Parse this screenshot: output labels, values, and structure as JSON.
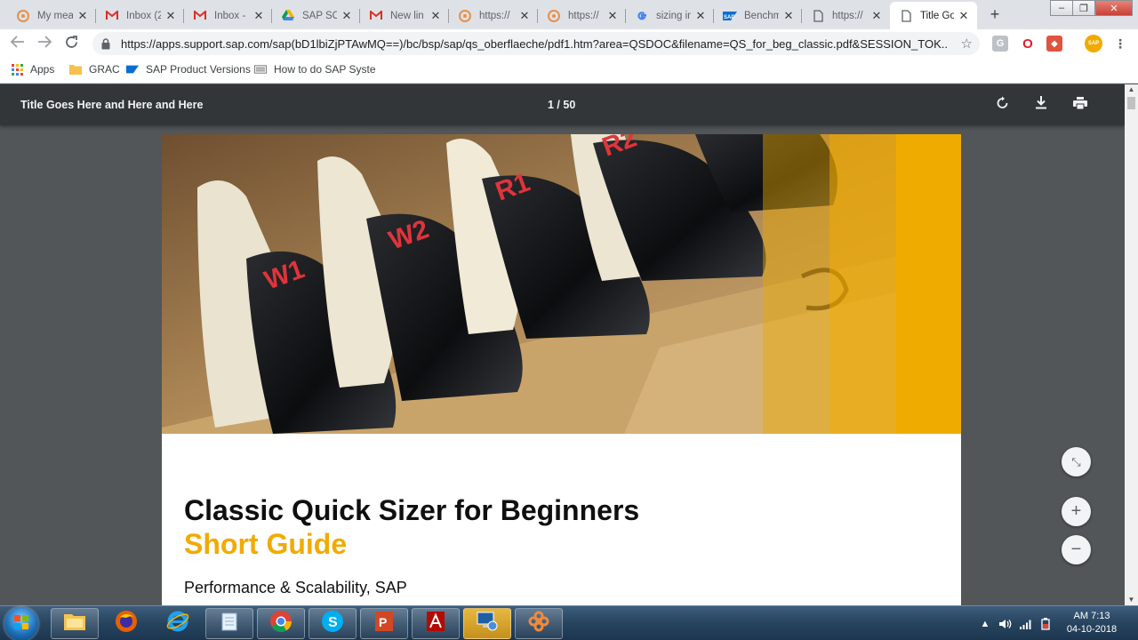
{
  "browser": {
    "tabs": [
      {
        "title": "My mea",
        "icon": "sap-flower-icon"
      },
      {
        "title": "Inbox (2",
        "icon": "gmail-icon"
      },
      {
        "title": "Inbox -",
        "icon": "gmail-icon"
      },
      {
        "title": "SAP SO",
        "icon": "google-drive-icon"
      },
      {
        "title": "New lin",
        "icon": "gmail-icon"
      },
      {
        "title": "https://",
        "icon": "sap-flower-icon"
      },
      {
        "title": "https://",
        "icon": "sap-flower-icon"
      },
      {
        "title": "sizing in",
        "icon": "google-icon"
      },
      {
        "title": "Benchm",
        "icon": "sap-logo-icon"
      },
      {
        "title": "https://",
        "icon": "page-icon"
      },
      {
        "title": "Title Go",
        "icon": "page-icon",
        "active": true
      }
    ],
    "new_tab_symbol": "+",
    "window_controls": {
      "minimize": "–",
      "maximize": "❐",
      "close": "✕"
    },
    "url": "https://apps.support.sap.com/sap(bD1lbiZjPTAwMQ==)/bc/bsp/sap/qs_oberflaeche/pdf1.htm?area=QSDOC&filename=QS_for_beg_classic.pdf&SESSION_TOK...",
    "extensions": [
      "G",
      "O",
      "◆",
      "SAP"
    ],
    "bookmarks": [
      {
        "label": "Apps",
        "icon": "apps-grid-icon"
      },
      {
        "label": "GRAC",
        "icon": "folder-icon"
      },
      {
        "label": "SAP Product Versions",
        "icon": "sap-logo-icon"
      },
      {
        "label": "How to do SAP Syste",
        "icon": "doc-icon"
      }
    ]
  },
  "pdf_viewer": {
    "title": "Title Goes Here and Here and Here",
    "page_indicator": "1  /  50",
    "document": {
      "title": "Classic Quick Sizer for Beginners",
      "subtitle": "Short Guide",
      "author_line": "Performance & Scalability, SAP",
      "hero_labels": [
        "W1",
        "W2",
        "R1",
        "R2"
      ]
    },
    "zoom_controls": {
      "fit": "⤡",
      "zoom_in": "+",
      "zoom_out": "−"
    }
  },
  "taskbar": {
    "apps": [
      "windows-explorer-icon",
      "firefox-icon",
      "internet-explorer-icon",
      "notepad-icon",
      "chrome-icon",
      "skype-icon",
      "powerpoint-icon",
      "acrobat-icon",
      "remote-desktop-icon",
      "sap-flower-icon"
    ],
    "clock": {
      "time": "AM 7:13",
      "date": "04-10-2018"
    }
  },
  "colors": {
    "sap_gold": "#f0ab00",
    "pdf_toolbar": "#323639",
    "pdf_background": "#525659"
  }
}
